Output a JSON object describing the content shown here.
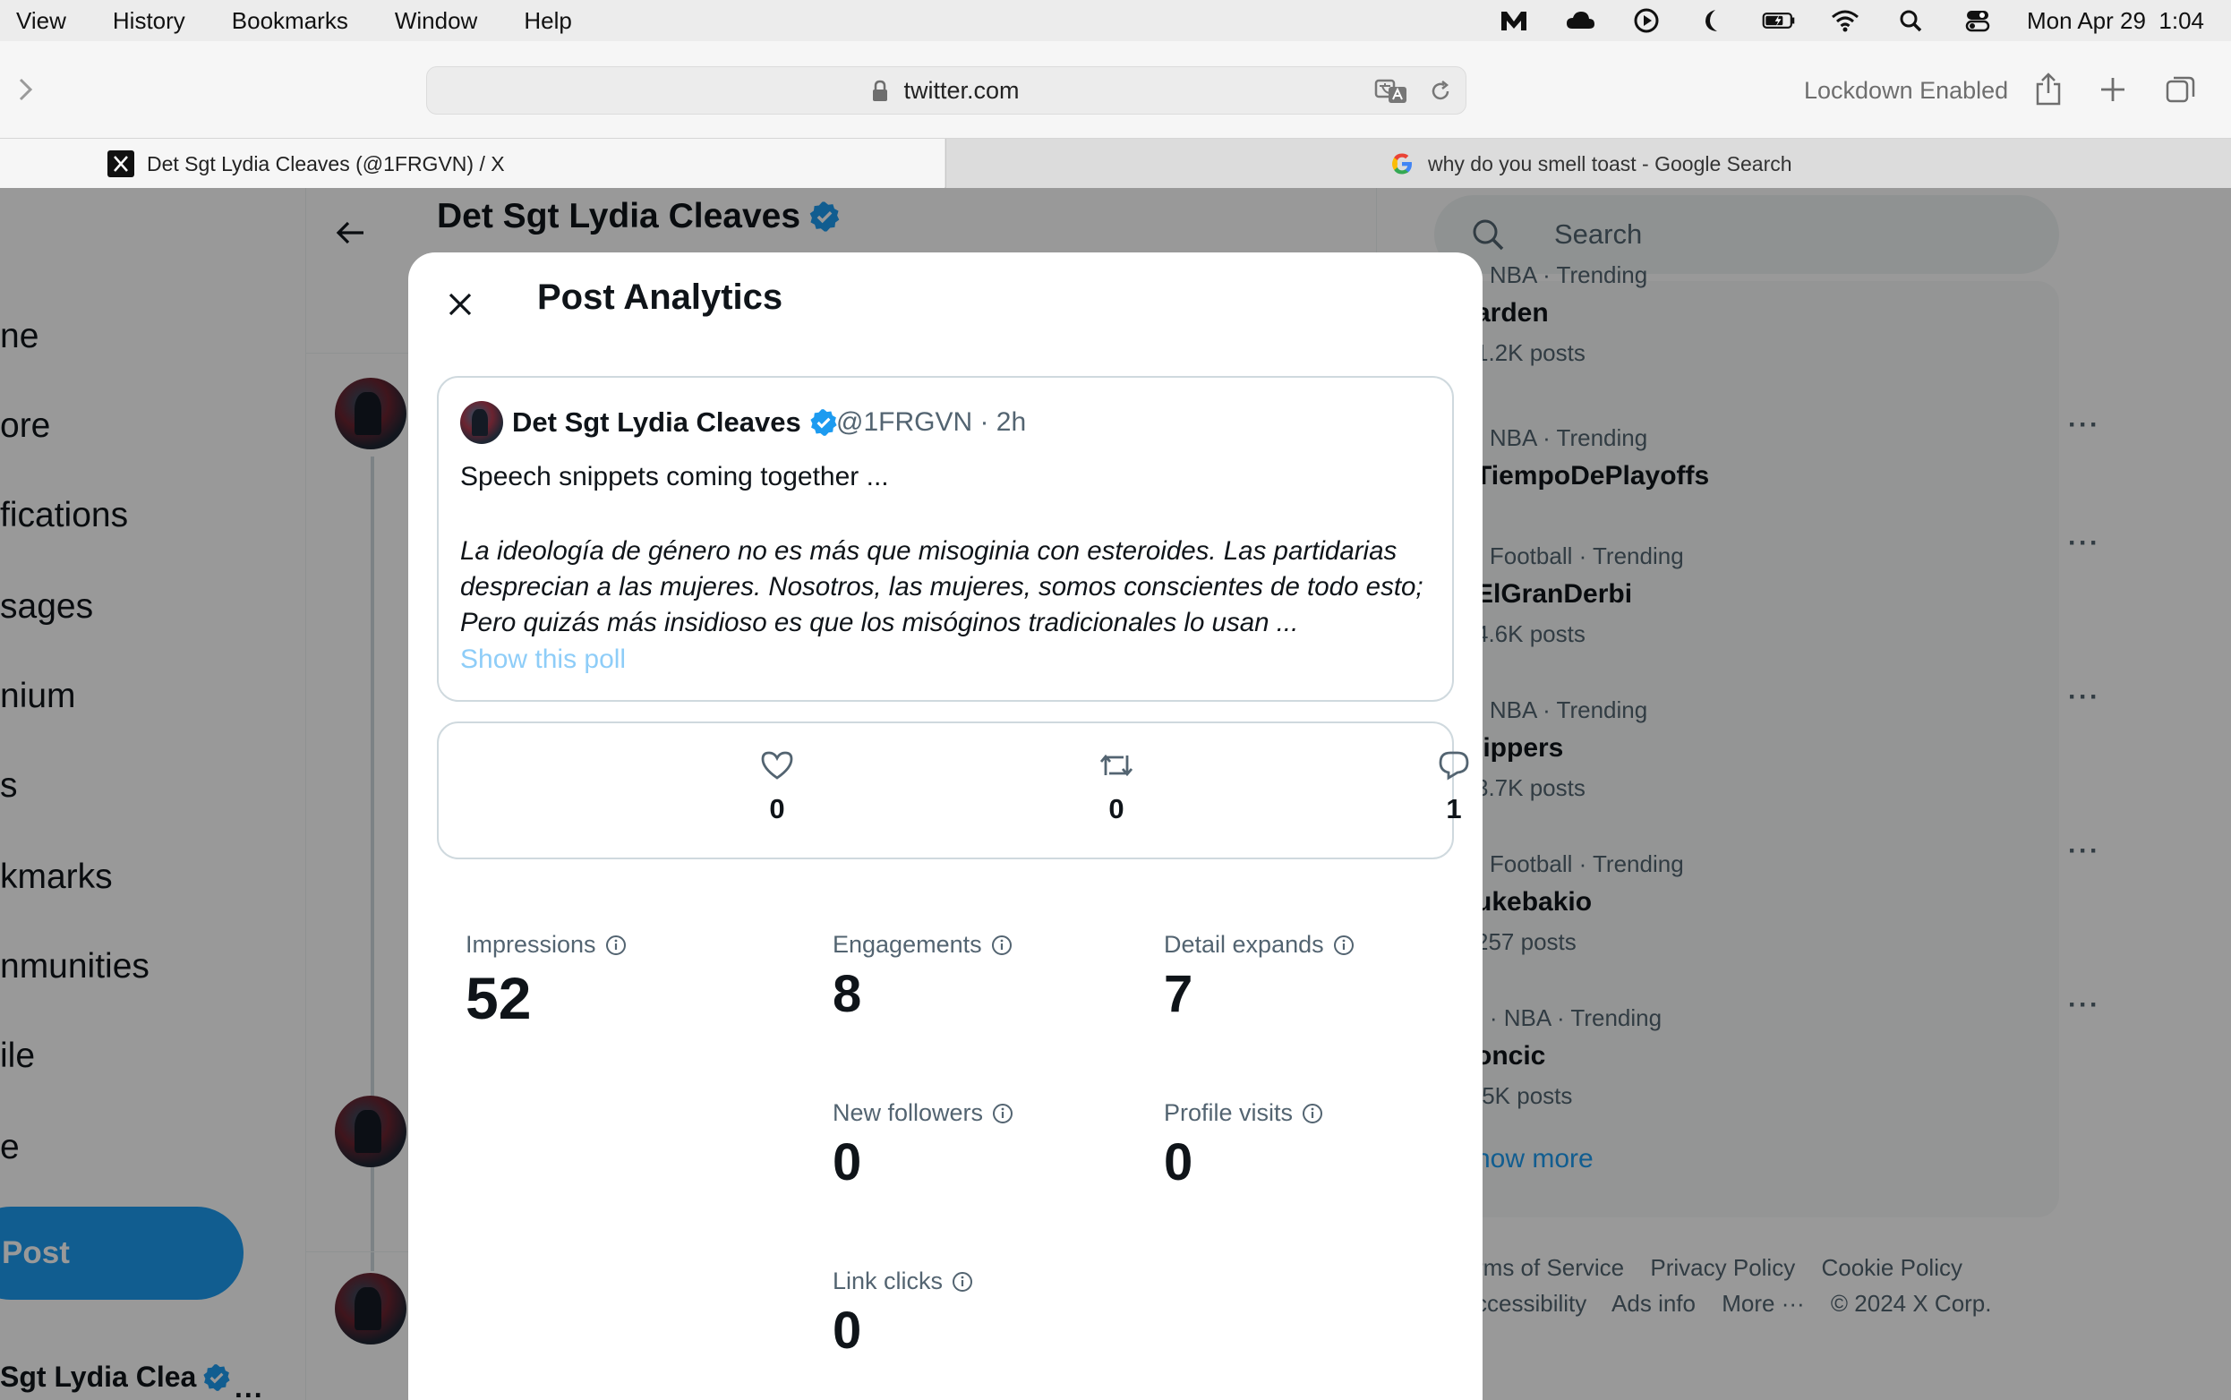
{
  "menubar": {
    "items": [
      "View",
      "History",
      "Bookmarks",
      "Window",
      "Help"
    ],
    "clock": "Mon Apr 29  1:04"
  },
  "toolbar": {
    "url": "twitter.com",
    "lockdown_label": "Lockdown Enabled"
  },
  "tabs": [
    {
      "title": "Det Sgt Lydia Cleaves (@1FRGVN) / X"
    },
    {
      "title": "why do you smell toast - Google Search"
    }
  ],
  "left_nav": {
    "items": [
      "ne",
      "ore",
      "fications",
      "sages",
      "nium",
      "s",
      "kmarks",
      "nmunities",
      "ile",
      "e"
    ],
    "post_label": "Post",
    "profile_name": "Sgt Lydia Clea",
    "more": "..."
  },
  "center": {
    "header_name": "Det Sgt Lydia Cleaves"
  },
  "right": {
    "search_placeholder": "Search",
    "trends": [
      {
        "meta": "· NBA · Trending",
        "name": "arden",
        "count": "1.2K posts"
      },
      {
        "meta": "· NBA · Trending",
        "name": "TiempoDePlayoffs",
        "count": ""
      },
      {
        "meta": "· Football · Trending",
        "name": "ElGranDerbi",
        "count": "4.6K posts"
      },
      {
        "meta": "· NBA · Trending",
        "name": "lippers",
        "count": "3.7K posts"
      },
      {
        "meta": "· Football · Trending",
        "name": "ukebakio",
        "count": "257 posts"
      },
      {
        "meta": ") · NBA · Trending",
        "name": "oncic",
        "count": ".5K posts"
      }
    ],
    "trend_more": "···",
    "show_more": "how more",
    "footer_row1": [
      "rms of Service",
      "Privacy Policy",
      "Cookie Policy"
    ],
    "footer_row2": [
      "ccessibility",
      "Ads info",
      "More ···",
      "© 2024 X Corp."
    ]
  },
  "modal": {
    "title": "Post Analytics",
    "post": {
      "author": "Det Sgt Lydia Cleaves",
      "handle": "@1FRGVN · 2h",
      "text": "Speech snippets coming together ...",
      "quote": "La ideología de género no es más que misoginia con esteroides. Las partidarias desprecian a las mujeres. Nosotros, las mujeres, somos conscientes de todo esto; Pero quizás más insidioso es que los misóginos tradicionales lo usan ...",
      "show_poll": "Show this poll"
    },
    "stats": {
      "likes": "0",
      "reposts": "0",
      "replies": "1"
    },
    "metrics": {
      "impressions": {
        "label": "Impressions",
        "value": "52"
      },
      "engagements": {
        "label": "Engagements",
        "value": "8"
      },
      "detail_expands": {
        "label": "Detail expands",
        "value": "7"
      },
      "new_followers": {
        "label": "New followers",
        "value": "0"
      },
      "profile_visits": {
        "label": "Profile visits",
        "value": "0"
      },
      "link_clicks": {
        "label": "Link clicks",
        "value": "0"
      }
    }
  },
  "colors": {
    "accent": "#1d9bf0",
    "verified": "#1d9bf0",
    "muted_text": "#536471"
  }
}
